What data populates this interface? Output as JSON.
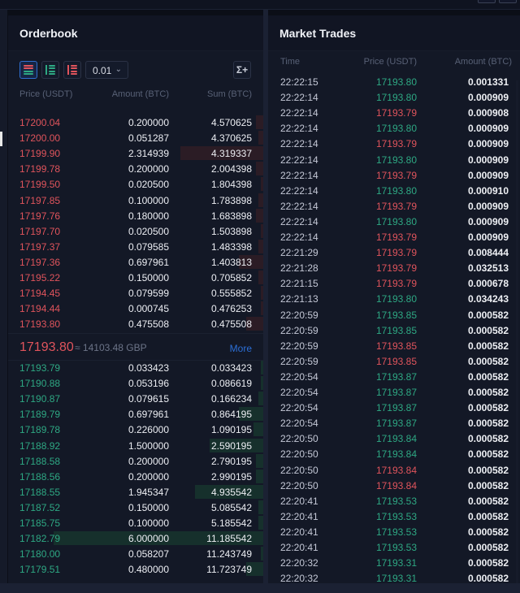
{
  "colors": {
    "ask": "#e0545c",
    "bid": "#2ea883",
    "accent": "#2c6fd6",
    "background": "#131826"
  },
  "orderbook": {
    "title": "Orderbook",
    "toolbar": {
      "views": [
        {
          "name": "both-sides",
          "icon": "orderbook-both-icon",
          "active": true
        },
        {
          "name": "bids-only",
          "icon": "orderbook-bids-icon",
          "active": false
        },
        {
          "name": "asks-only",
          "icon": "orderbook-asks-icon",
          "active": false
        }
      ],
      "precision": "0.01",
      "precision_icon": "chevron-down-icon",
      "sum_icon": "sum-toggle-icon",
      "sum_label": "Σ+"
    },
    "columns": {
      "price": "Price (USDT)",
      "amount": "Amount (BTC)",
      "sum": "Sum (BTC)"
    },
    "asks": [
      {
        "price": "17200.04",
        "amount": "0.200000",
        "sum": "4.570625",
        "depth": 0.03
      },
      {
        "price": "17200.00",
        "amount": "0.051287",
        "sum": "4.370625",
        "depth": 0.02
      },
      {
        "price": "17199.90",
        "amount": "2.314939",
        "sum": "4.319337",
        "depth": 0.34
      },
      {
        "price": "17199.78",
        "amount": "0.200000",
        "sum": "2.004398",
        "depth": 0.03
      },
      {
        "price": "17199.50",
        "amount": "0.020500",
        "sum": "1.804398",
        "depth": 0.01
      },
      {
        "price": "17197.85",
        "amount": "0.100000",
        "sum": "1.783898",
        "depth": 0.02
      },
      {
        "price": "17197.76",
        "amount": "0.180000",
        "sum": "1.683898",
        "depth": 0.03
      },
      {
        "price": "17197.70",
        "amount": "0.020500",
        "sum": "1.503898",
        "depth": 0.01
      },
      {
        "price": "17197.37",
        "amount": "0.079585",
        "sum": "1.483398",
        "depth": 0.02
      },
      {
        "price": "17197.36",
        "amount": "0.697961",
        "sum": "1.403813",
        "depth": 0.1
      },
      {
        "price": "17195.22",
        "amount": "0.150000",
        "sum": "0.705852",
        "depth": 0.02
      },
      {
        "price": "17194.45",
        "amount": "0.079599",
        "sum": "0.555852",
        "depth": 0.01
      },
      {
        "price": "17194.44",
        "amount": "0.000745",
        "sum": "0.476253",
        "depth": 0.01
      },
      {
        "price": "17193.80",
        "amount": "0.475508",
        "sum": "0.475508",
        "depth": 0.07
      }
    ],
    "mid": {
      "last_price": "17193.80",
      "approx": "≈ 14103.48 GBP",
      "more_label": "More"
    },
    "bids": [
      {
        "price": "17193.79",
        "amount": "0.033423",
        "sum": "0.033423",
        "depth": 0.01
      },
      {
        "price": "17190.88",
        "amount": "0.053196",
        "sum": "0.086619",
        "depth": 0.01
      },
      {
        "price": "17190.87",
        "amount": "0.079615",
        "sum": "0.166234",
        "depth": 0.02
      },
      {
        "price": "17189.79",
        "amount": "0.697961",
        "sum": "0.864195",
        "depth": 0.1
      },
      {
        "price": "17189.78",
        "amount": "0.226000",
        "sum": "1.090195",
        "depth": 0.04
      },
      {
        "price": "17188.92",
        "amount": "1.500000",
        "sum": "2.590195",
        "depth": 0.22
      },
      {
        "price": "17188.58",
        "amount": "0.200000",
        "sum": "2.790195",
        "depth": 0.03
      },
      {
        "price": "17188.56",
        "amount": "0.200000",
        "sum": "2.990195",
        "depth": 0.03
      },
      {
        "price": "17188.55",
        "amount": "1.945347",
        "sum": "4.935542",
        "depth": 0.28
      },
      {
        "price": "17187.52",
        "amount": "0.150000",
        "sum": "5.085542",
        "depth": 0.02
      },
      {
        "price": "17185.75",
        "amount": "0.100000",
        "sum": "5.185542",
        "depth": 0.02
      },
      {
        "price": "17182.79",
        "amount": "6.000000",
        "sum": "11.185542",
        "depth": 0.86
      },
      {
        "price": "17180.00",
        "amount": "0.058207",
        "sum": "11.243749",
        "depth": 0.01
      },
      {
        "price": "17179.51",
        "amount": "0.480000",
        "sum": "11.723749",
        "depth": 0.07
      }
    ]
  },
  "trades": {
    "title": "Market Trades",
    "columns": {
      "time": "Time",
      "price": "Price (USDT)",
      "amount": "Amount (BTC)"
    },
    "rows": [
      {
        "time": "22:22:15",
        "price": "17193.80",
        "amount": "0.001331",
        "side": "buy"
      },
      {
        "time": "22:22:14",
        "price": "17193.80",
        "amount": "0.000909",
        "side": "buy"
      },
      {
        "time": "22:22:14",
        "price": "17193.79",
        "amount": "0.000908",
        "side": "sell"
      },
      {
        "time": "22:22:14",
        "price": "17193.80",
        "amount": "0.000909",
        "side": "buy"
      },
      {
        "time": "22:22:14",
        "price": "17193.79",
        "amount": "0.000909",
        "side": "sell"
      },
      {
        "time": "22:22:14",
        "price": "17193.80",
        "amount": "0.000909",
        "side": "buy"
      },
      {
        "time": "22:22:14",
        "price": "17193.79",
        "amount": "0.000909",
        "side": "sell"
      },
      {
        "time": "22:22:14",
        "price": "17193.80",
        "amount": "0.000910",
        "side": "buy"
      },
      {
        "time": "22:22:14",
        "price": "17193.79",
        "amount": "0.000909",
        "side": "sell"
      },
      {
        "time": "22:22:14",
        "price": "17193.80",
        "amount": "0.000909",
        "side": "buy"
      },
      {
        "time": "22:22:14",
        "price": "17193.79",
        "amount": "0.000909",
        "side": "sell"
      },
      {
        "time": "22:21:29",
        "price": "17193.79",
        "amount": "0.008444",
        "side": "sell"
      },
      {
        "time": "22:21:28",
        "price": "17193.79",
        "amount": "0.032513",
        "side": "sell"
      },
      {
        "time": "22:21:15",
        "price": "17193.79",
        "amount": "0.000678",
        "side": "sell"
      },
      {
        "time": "22:21:13",
        "price": "17193.80",
        "amount": "0.034243",
        "side": "buy"
      },
      {
        "time": "22:20:59",
        "price": "17193.85",
        "amount": "0.000582",
        "side": "buy"
      },
      {
        "time": "22:20:59",
        "price": "17193.85",
        "amount": "0.000582",
        "side": "buy"
      },
      {
        "time": "22:20:59",
        "price": "17193.85",
        "amount": "0.000582",
        "side": "sell"
      },
      {
        "time": "22:20:59",
        "price": "17193.85",
        "amount": "0.000582",
        "side": "sell"
      },
      {
        "time": "22:20:54",
        "price": "17193.87",
        "amount": "0.000582",
        "side": "buy"
      },
      {
        "time": "22:20:54",
        "price": "17193.87",
        "amount": "0.000582",
        "side": "buy"
      },
      {
        "time": "22:20:54",
        "price": "17193.87",
        "amount": "0.000582",
        "side": "buy"
      },
      {
        "time": "22:20:54",
        "price": "17193.87",
        "amount": "0.000582",
        "side": "buy"
      },
      {
        "time": "22:20:50",
        "price": "17193.84",
        "amount": "0.000582",
        "side": "buy"
      },
      {
        "time": "22:20:50",
        "price": "17193.84",
        "amount": "0.000582",
        "side": "buy"
      },
      {
        "time": "22:20:50",
        "price": "17193.84",
        "amount": "0.000582",
        "side": "sell"
      },
      {
        "time": "22:20:50",
        "price": "17193.84",
        "amount": "0.000582",
        "side": "sell"
      },
      {
        "time": "22:20:41",
        "price": "17193.53",
        "amount": "0.000582",
        "side": "buy"
      },
      {
        "time": "22:20:41",
        "price": "17193.53",
        "amount": "0.000582",
        "side": "buy"
      },
      {
        "time": "22:20:41",
        "price": "17193.53",
        "amount": "0.000582",
        "side": "buy"
      },
      {
        "time": "22:20:41",
        "price": "17193.53",
        "amount": "0.000582",
        "side": "buy"
      },
      {
        "time": "22:20:32",
        "price": "17193.31",
        "amount": "0.000582",
        "side": "buy"
      },
      {
        "time": "22:20:32",
        "price": "17193.31",
        "amount": "0.000582",
        "side": "buy"
      }
    ]
  }
}
